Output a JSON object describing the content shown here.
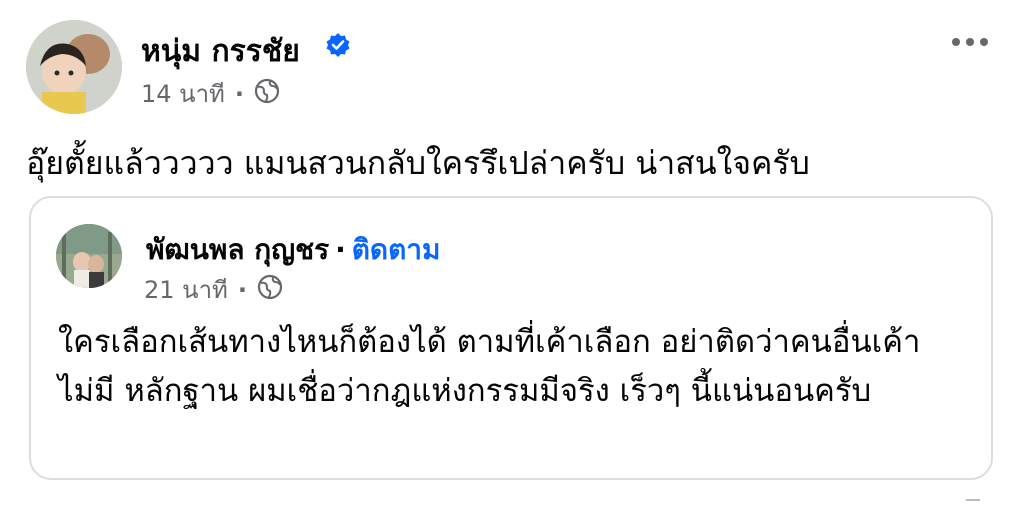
{
  "post": {
    "author_name": "หนุ่ม กรรชัย",
    "verified": true,
    "time": "14 นาที",
    "audience_icon": "globe-icon",
    "text": "อุ๊ยตั้ยแล้ววววว แมนสวนกลับใครรึเปล่าครับ น่าสนใจครับ"
  },
  "shared_post": {
    "author_name": "พัฒนพล กุญชร",
    "separator": "·",
    "follow_label": "ติดตาม",
    "time": "21 นาที",
    "audience_icon": "globe-icon",
    "text": "ใครเลือกเส้นทางไหนก็ต้องได้ ตามที่เค้าเลือก อย่าติดว่าคนอื่นเค้าไม่มี หลักฐาน ผมเชื่อว่ากฎแห่งกรรมมีจริง เร็วๆ นี้แน่นอนครับ"
  },
  "colors": {
    "link_blue": "#0866ff",
    "verified_blue": "#0866ff",
    "meta_gray": "#65676b",
    "border": "#dadde1"
  }
}
